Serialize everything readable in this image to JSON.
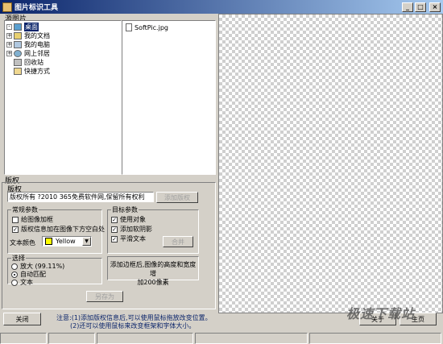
{
  "window": {
    "title": "图片标识工具",
    "controls": [
      "_",
      "□",
      "×"
    ]
  },
  "source_panel": {
    "label": "源图片",
    "tree": [
      {
        "label": "桌面",
        "icon": "desktop-icon",
        "expander": "-",
        "selected": true,
        "indent": 0
      },
      {
        "label": "我的文档",
        "icon": "folder-icon",
        "expander": "+",
        "selected": false,
        "indent": 1
      },
      {
        "label": "我的电脑",
        "icon": "computer-icon",
        "expander": "+",
        "selected": false,
        "indent": 1
      },
      {
        "label": "网上邻居",
        "icon": "network-icon",
        "expander": "+",
        "selected": false,
        "indent": 1
      },
      {
        "label": "回收站",
        "icon": "recycle-bin-icon",
        "expander": "",
        "selected": false,
        "indent": 1
      },
      {
        "label": "快捷方式",
        "icon": "shortcut-folder-icon",
        "expander": "",
        "selected": false,
        "indent": 1
      }
    ],
    "files": [
      "SoftPic.jpg"
    ]
  },
  "copyright": {
    "section_label": "版权",
    "field_label": "版权",
    "text_value": "版权所有 ?2010 365免费软件网,保留所有权利",
    "add_button": "添加版权",
    "general_params": {
      "label": "常规参数",
      "add_frame": "给图像加框",
      "add_frame_checked": false,
      "blank_below": "版权信息加在图像下方空白处",
      "blank_below_checked": true,
      "text_color_label": "文本颜色",
      "text_color_value": "Yellow",
      "text_color_hex": "#ffff00"
    },
    "target_params": {
      "label": "目标参数",
      "use_object": "使用对象",
      "use_object_checked": true,
      "add_shadow": "添加软阴影",
      "add_shadow_checked": true,
      "smooth_text": "平滑文本",
      "smooth_text_checked": true,
      "merge_button": "合并"
    },
    "select": {
      "label": "选择",
      "options": [
        {
          "label": "放大 (99.11%)",
          "selected": false
        },
        {
          "label": "自动匹配",
          "selected": true
        },
        {
          "label": "文本",
          "selected": false
        }
      ]
    },
    "hint": [
      "添加边框后,图像的高度和宽度增",
      "加200像素"
    ],
    "save_as_button": "另存为"
  },
  "bottom": {
    "close_button": "关闭",
    "notice_line1": "注意:(1)添加版权信息后,可以使用鼠标拖放改变位置。",
    "notice_line2": "(2)还可以使用鼠标来改变框架和字体大小。",
    "about_button": "关于",
    "home_button": "主页"
  },
  "watermark": "极速下载站"
}
